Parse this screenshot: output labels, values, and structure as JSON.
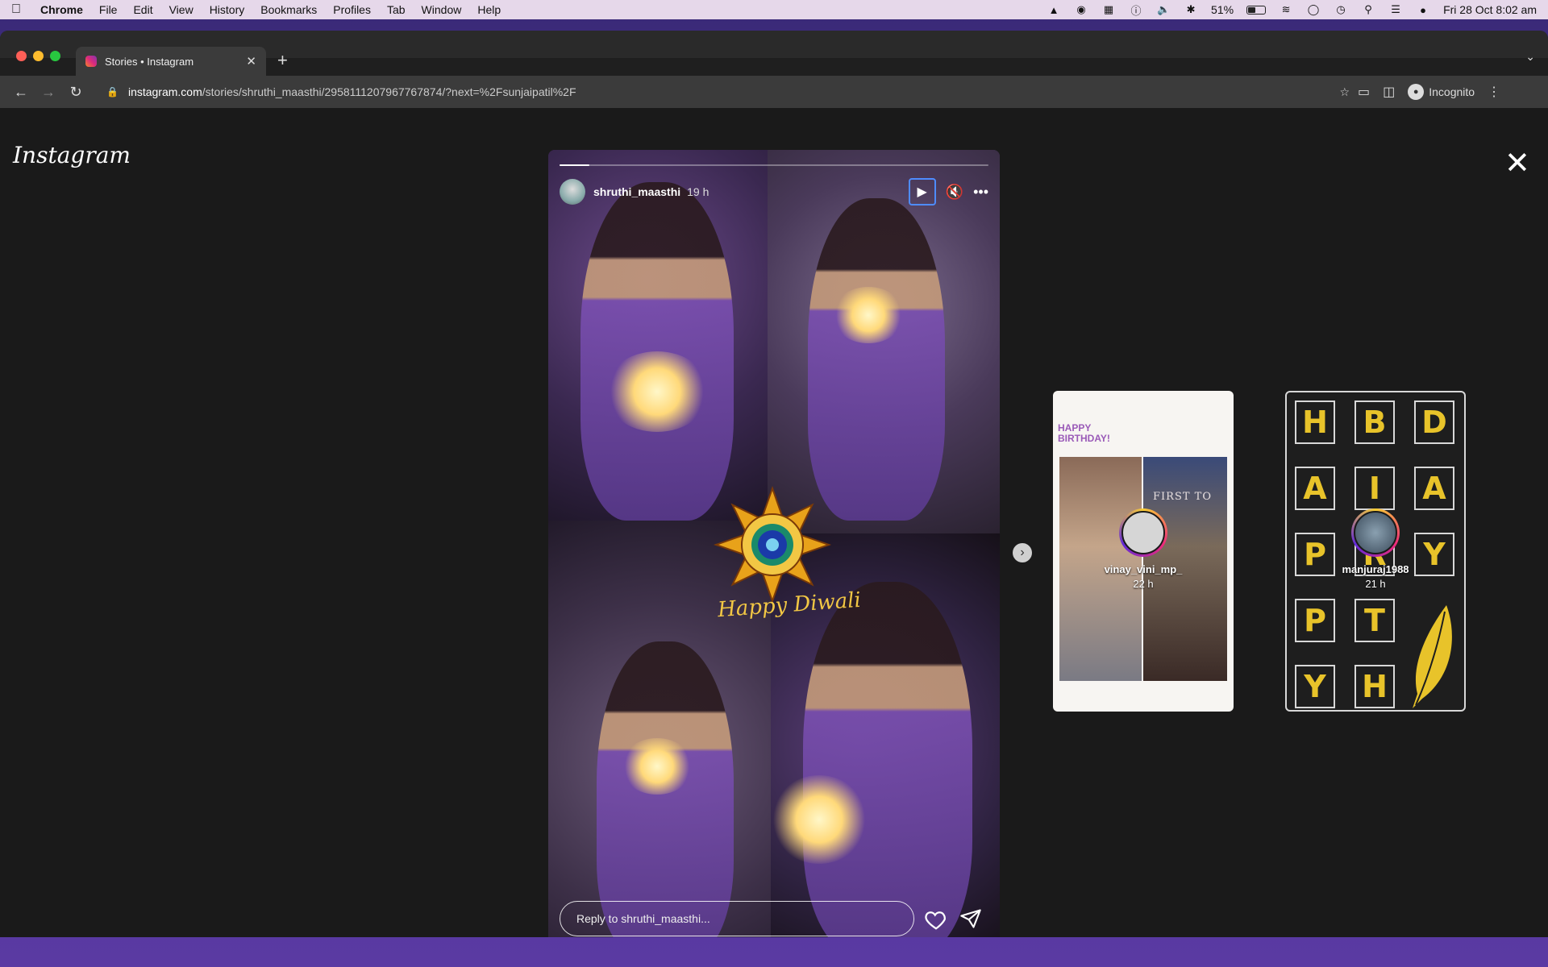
{
  "menubar": {
    "app": "Chrome",
    "items": [
      "File",
      "Edit",
      "View",
      "History",
      "Bookmarks",
      "Profiles",
      "Tab",
      "Window",
      "Help"
    ],
    "battery": "51%",
    "battery_level": 0.51,
    "datetime": "Fri 28 Oct  8:02 am"
  },
  "browser": {
    "tab_title": "Stories • Instagram",
    "url_host": "instagram.com",
    "url_path": "/stories/shruthi_maasthi/2958111207967767874/?next=%2Fsunjaipatil%2F",
    "profile_label": "Incognito"
  },
  "instagram": {
    "logo": "Instagram",
    "story": {
      "username": "shruthi_maasthi",
      "time": "19 h",
      "progress": 0.07,
      "overlay_text": "Happy Diwali",
      "reply_placeholder": "Reply to shruthi_maasthi..."
    },
    "previews": [
      {
        "username": "vinay_vini_mp_",
        "time": "22 h",
        "badge_line1": "HAPPY",
        "badge_line2": "BIRTHDAY!",
        "photo_text": "FIRST TO"
      },
      {
        "username": "manjuraj1988",
        "time": "21 h",
        "letters": [
          "H",
          "B",
          "D",
          "A",
          "I",
          "A",
          "P",
          "R",
          "Y",
          "P",
          "T",
          "Y",
          "H"
        ]
      }
    ]
  },
  "colors": {
    "accent_focus": "#4e8cff",
    "tile_gold": "#e8c32a"
  }
}
